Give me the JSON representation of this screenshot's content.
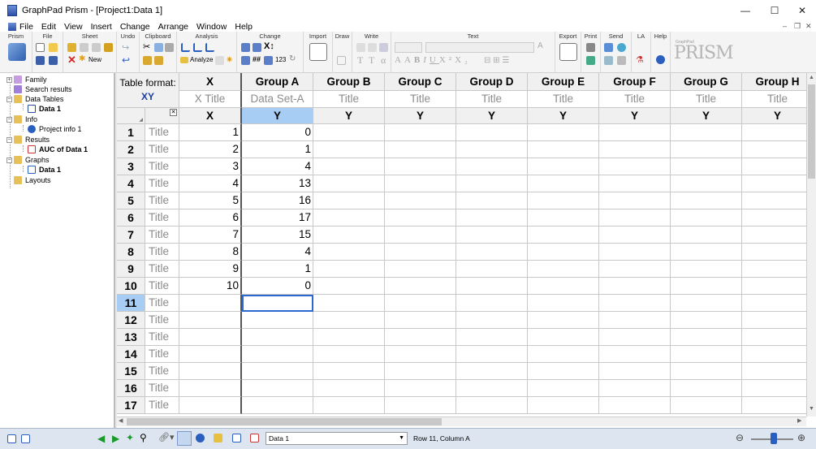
{
  "window": {
    "title": "GraphPad Prism - [Project1:Data 1]",
    "minimize_glyph": "—",
    "maximize_glyph": "☐",
    "close_glyph": "✕"
  },
  "menu": [
    "File",
    "Edit",
    "View",
    "Insert",
    "Change",
    "Arrange",
    "Window",
    "Help"
  ],
  "ribbon": {
    "groups": [
      "Prism",
      "File",
      "Sheet",
      "Undo",
      "Clipboard",
      "Analysis",
      "Change",
      "Import",
      "Draw",
      "Write",
      "Text",
      "Export",
      "Print",
      "Send",
      "LA",
      "Help"
    ],
    "new_label": "New",
    "analyze_label": "Analyze",
    "logo_small": "GraphPad",
    "logo_big": "PRISM"
  },
  "sidebar": {
    "items": [
      {
        "label": "Family",
        "bold": false
      },
      {
        "label": "Search results",
        "bold": false
      },
      {
        "label": "Data Tables",
        "bold": false
      },
      {
        "label": "Data 1",
        "bold": true
      },
      {
        "label": "Info",
        "bold": false
      },
      {
        "label": "Project info 1",
        "bold": false
      },
      {
        "label": "Results",
        "bold": false
      },
      {
        "label": "AUC of Data 1",
        "bold": true
      },
      {
        "label": "Graphs",
        "bold": false
      },
      {
        "label": "Data 1",
        "bold": true
      },
      {
        "label": "Layouts",
        "bold": false
      }
    ]
  },
  "table": {
    "format_label": "Table format:",
    "format_value": "XY",
    "columns": [
      {
        "header": "X",
        "subtitle": "X Title",
        "kind": "X"
      },
      {
        "header": "Group A",
        "subtitle": "Data Set-A",
        "kind": "Y"
      },
      {
        "header": "Group B",
        "subtitle": "Title",
        "kind": "Y"
      },
      {
        "header": "Group C",
        "subtitle": "Title",
        "kind": "Y"
      },
      {
        "header": "Group D",
        "subtitle": "Title",
        "kind": "Y"
      },
      {
        "header": "Group E",
        "subtitle": "Title",
        "kind": "Y"
      },
      {
        "header": "Group F",
        "subtitle": "Title",
        "kind": "Y"
      },
      {
        "header": "Group G",
        "subtitle": "Title",
        "kind": "Y"
      },
      {
        "header": "Group H",
        "subtitle": "Title",
        "kind": "Y"
      }
    ],
    "row_title_placeholder": "Title",
    "row_numbers": [
      "1",
      "2",
      "3",
      "4",
      "5",
      "6",
      "7",
      "8",
      "9",
      "10",
      "11",
      "12",
      "13",
      "14",
      "15",
      "16",
      "17"
    ],
    "x_values": [
      "1",
      "2",
      "3",
      "4",
      "5",
      "6",
      "7",
      "8",
      "9",
      "10"
    ],
    "groupA_values": [
      "0",
      "1",
      "4",
      "13",
      "16",
      "17",
      "15",
      "4",
      "1",
      "0"
    ],
    "selected_row": 11,
    "selected_column": "Group A"
  },
  "statusbar": {
    "sheet_select": "Data 1",
    "position": "Row 11, Column A"
  },
  "colors": {
    "selected_header": "#a8cdf5",
    "format_text": "#1a3fa0",
    "selection_border": "#2a6ad0"
  }
}
